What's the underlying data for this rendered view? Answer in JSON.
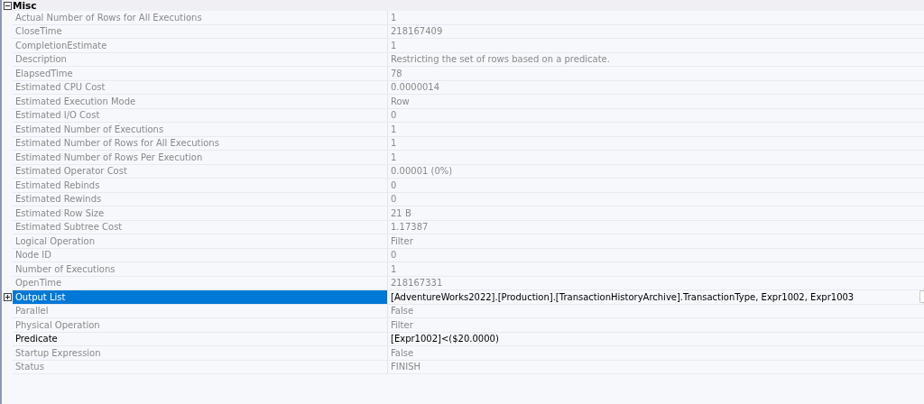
{
  "category": {
    "title": "Misc",
    "expanded": true
  },
  "rows": [
    {
      "name": "Actual Number of Rows for All Executions",
      "value": "1",
      "readonly": true,
      "selected": false
    },
    {
      "name": "CloseTime",
      "value": "218167409",
      "readonly": true,
      "selected": false
    },
    {
      "name": "CompletionEstimate",
      "value": "1",
      "readonly": true,
      "selected": false
    },
    {
      "name": "Description",
      "value": "Restricting the set of rows based on a predicate.",
      "readonly": true,
      "selected": false
    },
    {
      "name": "ElapsedTime",
      "value": "78",
      "readonly": true,
      "selected": false
    },
    {
      "name": "Estimated CPU Cost",
      "value": "0.0000014",
      "readonly": true,
      "selected": false
    },
    {
      "name": "Estimated Execution Mode",
      "value": "Row",
      "readonly": true,
      "selected": false
    },
    {
      "name": "Estimated I/O Cost",
      "value": "0",
      "readonly": true,
      "selected": false
    },
    {
      "name": "Estimated Number of Executions",
      "value": "1",
      "readonly": true,
      "selected": false
    },
    {
      "name": "Estimated Number of Rows for All Executions",
      "value": "1",
      "readonly": true,
      "selected": false
    },
    {
      "name": "Estimated Number of Rows Per Execution",
      "value": "1",
      "readonly": true,
      "selected": false
    },
    {
      "name": "Estimated Operator Cost",
      "value": "0.00001 (0%)",
      "readonly": true,
      "selected": false
    },
    {
      "name": "Estimated Rebinds",
      "value": "0",
      "readonly": true,
      "selected": false
    },
    {
      "name": "Estimated Rewinds",
      "value": "0",
      "readonly": true,
      "selected": false
    },
    {
      "name": "Estimated Row Size",
      "value": "21 B",
      "readonly": true,
      "selected": false
    },
    {
      "name": "Estimated Subtree Cost",
      "value": "1.17387",
      "readonly": true,
      "selected": false
    },
    {
      "name": "Logical Operation",
      "value": "Filter",
      "readonly": true,
      "selected": false
    },
    {
      "name": "Node ID",
      "value": "0",
      "readonly": true,
      "selected": false
    },
    {
      "name": "Number of Executions",
      "value": "1",
      "readonly": true,
      "selected": false
    },
    {
      "name": "OpenTime",
      "value": "218167331",
      "readonly": true,
      "selected": false
    },
    {
      "name": "Output List",
      "value": "[AdventureWorks2022].[Production].[TransactionHistoryArchive].TransactionType, Expr1002, Expr1003",
      "readonly": false,
      "selected": true,
      "expandable": true,
      "expanded": false
    },
    {
      "name": "Parallel",
      "value": "False",
      "readonly": true,
      "selected": false
    },
    {
      "name": "Physical Operation",
      "value": "Filter",
      "readonly": true,
      "selected": false
    },
    {
      "name": "Predicate",
      "value": "[Expr1002]<($20.0000)",
      "readonly": false,
      "selected": false
    },
    {
      "name": "Startup Expression",
      "value": "False",
      "readonly": true,
      "selected": false
    },
    {
      "name": "Status",
      "value": "FINISH",
      "readonly": true,
      "selected": false
    }
  ]
}
